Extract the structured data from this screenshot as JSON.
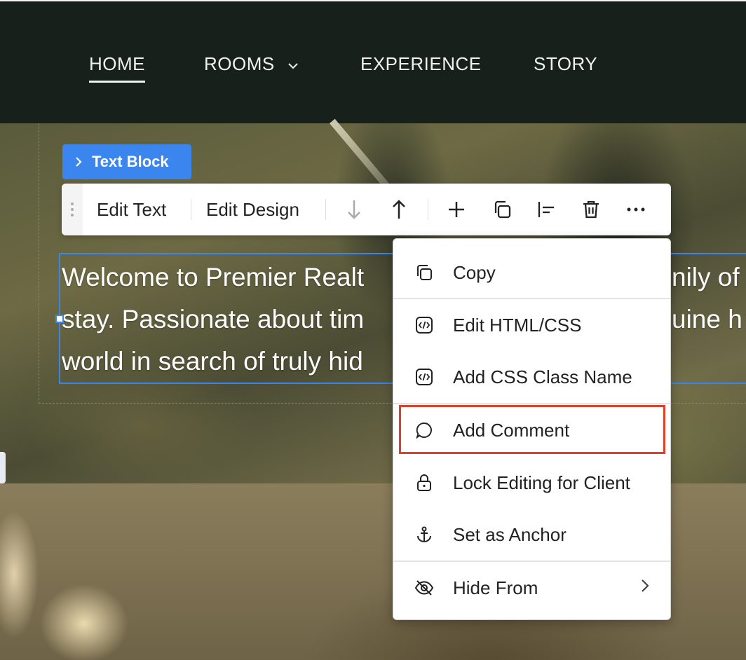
{
  "nav": {
    "items": [
      {
        "label": "HOME",
        "active": true
      },
      {
        "label": "ROOMS",
        "has_dropdown": true
      },
      {
        "label": "EXPERIENCE"
      },
      {
        "label": "STORY"
      }
    ]
  },
  "editor": {
    "element_tag": "Text Block",
    "toolbar": {
      "edit_text": "Edit Text",
      "edit_design": "Edit Design"
    },
    "text_lines": [
      "Welcome to Premier Realt",
      "stay. Passionate about tim",
      "world in search of truly hid",
      "nily of",
      "uine h"
    ]
  },
  "context_menu": {
    "items": [
      {
        "label": "Copy",
        "icon": "copy-icon"
      },
      {
        "label": "Edit HTML/CSS",
        "icon": "code-icon"
      },
      {
        "label": "Add CSS Class Name",
        "icon": "code-icon"
      },
      {
        "label": "Add Comment",
        "icon": "comment-icon",
        "highlighted": true
      },
      {
        "label": "Lock Editing for Client",
        "icon": "lock-icon"
      },
      {
        "label": "Set as Anchor",
        "icon": "anchor-icon"
      },
      {
        "label": "Hide From",
        "icon": "eye-off-icon",
        "has_submenu": true
      }
    ]
  },
  "colors": {
    "accent": "#3a86ee",
    "highlight": "#e0402a",
    "nav_bg": "#18201b"
  }
}
